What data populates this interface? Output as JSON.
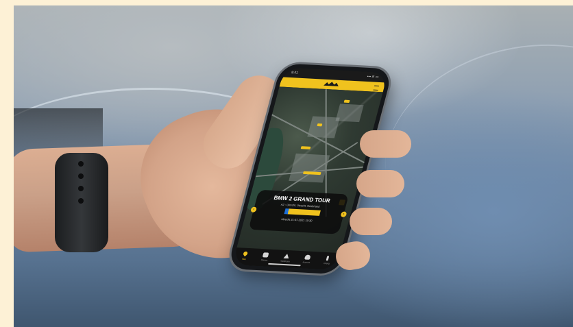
{
  "status_bar": {
    "time": "9:41",
    "icons": "••• ≋ ▭"
  },
  "app_bar": {
    "logo": "logo-icon",
    "menu": "menu-icon"
  },
  "map": {
    "accent_color": "#f0c21e"
  },
  "tour_card": {
    "title": "BMW 2 GRAND TOUR",
    "location": "A2 - Utrecht, Utrecht, Nederland",
    "progress": 0.1,
    "date": "Utrecht 21-07-2021 10:30",
    "prev_icon": "chevron-left-icon",
    "next_icon": "chevron-right-icon"
  },
  "tab_bar": {
    "items": [
      {
        "label": "Map",
        "icon": "map-pin-icon",
        "active": true
      },
      {
        "label": "Routes",
        "icon": "car-icon",
        "active": false
      },
      {
        "label": "Meldingen",
        "icon": "alert-icon",
        "active": false
      },
      {
        "label": "Account",
        "icon": "user-icon",
        "active": false
      },
      {
        "label": "Overig",
        "icon": "info-icon",
        "active": false
      }
    ]
  }
}
